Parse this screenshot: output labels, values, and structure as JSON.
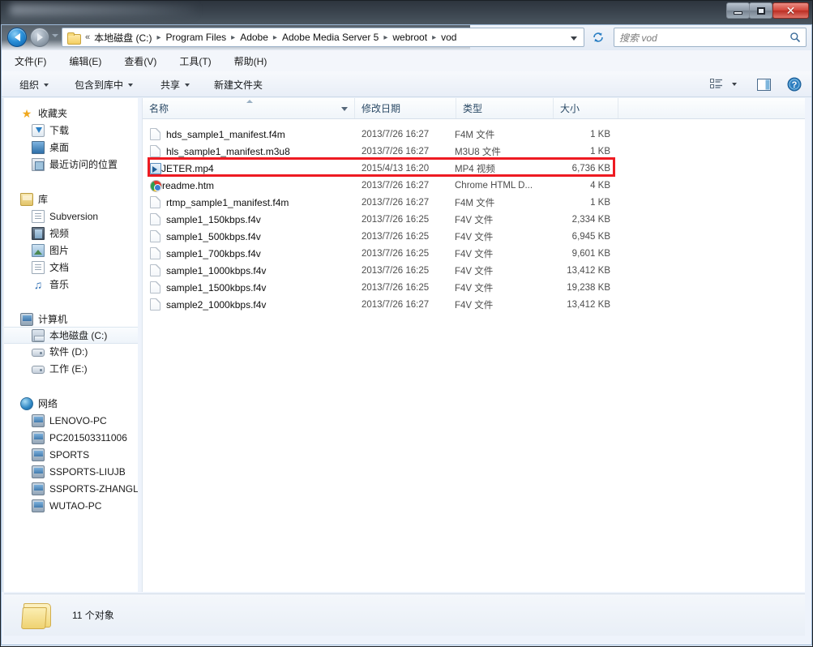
{
  "window": {
    "title": "",
    "controls": {
      "minimize": "minimize-button",
      "maximize": "maximize-button",
      "close": "✕"
    }
  },
  "address_bar": {
    "back_tooltip": "后退",
    "forward_tooltip": "前进",
    "prefix": "«",
    "breadcrumbs": [
      "本地磁盘 (C:)",
      "Program Files",
      "Adobe",
      "Adobe Media Server 5",
      "webroot",
      "vod"
    ],
    "separator": "▸",
    "refresh": "refresh-button"
  },
  "search": {
    "placeholder": "搜索 vod"
  },
  "menu": {
    "items": [
      "文件(F)",
      "编辑(E)",
      "查看(V)",
      "工具(T)",
      "帮助(H)"
    ]
  },
  "toolbar": {
    "organize": "组织",
    "include_in_library": "包含到库中",
    "share": "共享",
    "new_folder": "新建文件夹",
    "view_options": "view-options-icon",
    "preview_pane": "preview-pane-icon",
    "help": "help-icon"
  },
  "sidebar": {
    "groups": [
      {
        "header": {
          "label": "收藏夹",
          "icon": "star-icon"
        },
        "items": [
          {
            "label": "下载",
            "icon": "download-icon",
            "selected": false
          },
          {
            "label": "桌面",
            "icon": "desktop-icon",
            "selected": false
          },
          {
            "label": "最近访问的位置",
            "icon": "recent-places-icon",
            "selected": false
          }
        ]
      },
      {
        "header": {
          "label": "库",
          "icon": "library-icon"
        },
        "items": [
          {
            "label": "Subversion",
            "icon": "document-icon",
            "selected": false
          },
          {
            "label": "视频",
            "icon": "video-icon",
            "selected": false
          },
          {
            "label": "图片",
            "icon": "picture-icon",
            "selected": false
          },
          {
            "label": "文档",
            "icon": "document-icon",
            "selected": false
          },
          {
            "label": "音乐",
            "icon": "music-icon",
            "selected": false
          }
        ]
      },
      {
        "header": {
          "label": "计算机",
          "icon": "computer-icon"
        },
        "items": [
          {
            "label": "本地磁盘 (C:)",
            "icon": "system-drive-icon",
            "selected": true
          },
          {
            "label": "软件 (D:)",
            "icon": "drive-icon",
            "selected": false
          },
          {
            "label": "工作 (E:)",
            "icon": "drive-icon",
            "selected": false
          }
        ]
      },
      {
        "header": {
          "label": "网络",
          "icon": "network-icon"
        },
        "items": [
          {
            "label": "LENOVO-PC",
            "icon": "computer-node-icon",
            "selected": false
          },
          {
            "label": "PC201503311006",
            "icon": "computer-node-icon",
            "selected": false
          },
          {
            "label": "SPORTS",
            "icon": "computer-node-icon",
            "selected": false
          },
          {
            "label": "SSPORTS-LIUJB",
            "icon": "computer-node-icon",
            "selected": false
          },
          {
            "label": "SSPORTS-ZHANGL",
            "icon": "computer-node-icon",
            "selected": false
          },
          {
            "label": "WUTAO-PC",
            "icon": "computer-node-icon",
            "selected": false
          }
        ]
      }
    ]
  },
  "file_list": {
    "columns": [
      {
        "label": "名称",
        "sorted": "asc"
      },
      {
        "label": "修改日期",
        "sorted": ""
      },
      {
        "label": "类型",
        "sorted": ""
      },
      {
        "label": "大小",
        "sorted": ""
      }
    ],
    "rows": [
      {
        "name": "hds_sample1_manifest.f4m",
        "date": "2013/7/26 16:27",
        "type": "F4M 文件",
        "size": "1 KB",
        "icon": "generic-file-icon",
        "highlighted": false
      },
      {
        "name": "hls_sample1_manifest.m3u8",
        "date": "2013/7/26 16:27",
        "type": "M3U8 文件",
        "size": "1 KB",
        "icon": "generic-file-icon",
        "highlighted": false
      },
      {
        "name": "JETER.mp4",
        "date": "2015/4/13 16:20",
        "type": "MP4 视频",
        "size": "6,736 KB",
        "icon": "mp4-video-icon",
        "highlighted": true
      },
      {
        "name": "readme.htm",
        "date": "2013/7/26 16:27",
        "type": "Chrome HTML D...",
        "size": "4 KB",
        "icon": "chrome-icon",
        "highlighted": false
      },
      {
        "name": "rtmp_sample1_manifest.f4m",
        "date": "2013/7/26 16:27",
        "type": "F4M 文件",
        "size": "1 KB",
        "icon": "generic-file-icon",
        "highlighted": false
      },
      {
        "name": "sample1_150kbps.f4v",
        "date": "2013/7/26 16:25",
        "type": "F4V 文件",
        "size": "2,334 KB",
        "icon": "generic-file-icon",
        "highlighted": false
      },
      {
        "name": "sample1_500kbps.f4v",
        "date": "2013/7/26 16:25",
        "type": "F4V 文件",
        "size": "6,945 KB",
        "icon": "generic-file-icon",
        "highlighted": false
      },
      {
        "name": "sample1_700kbps.f4v",
        "date": "2013/7/26 16:25",
        "type": "F4V 文件",
        "size": "9,601 KB",
        "icon": "generic-file-icon",
        "highlighted": false
      },
      {
        "name": "sample1_1000kbps.f4v",
        "date": "2013/7/26 16:25",
        "type": "F4V 文件",
        "size": "13,412 KB",
        "icon": "generic-file-icon",
        "highlighted": false
      },
      {
        "name": "sample1_1500kbps.f4v",
        "date": "2013/7/26 16:25",
        "type": "F4V 文件",
        "size": "19,238 KB",
        "icon": "generic-file-icon",
        "highlighted": false
      },
      {
        "name": "sample2_1000kbps.f4v",
        "date": "2013/7/26 16:27",
        "type": "F4V 文件",
        "size": "13,412 KB",
        "icon": "generic-file-icon",
        "highlighted": false
      }
    ]
  },
  "status_bar": {
    "item_count_text": "11 个对象",
    "folder_icon": "folder-icon"
  },
  "colors": {
    "annotation": "#ee1b22",
    "titlebar": "#39424c",
    "chrome_bg": "#eef3fb",
    "header_text": "#2b4a66"
  }
}
